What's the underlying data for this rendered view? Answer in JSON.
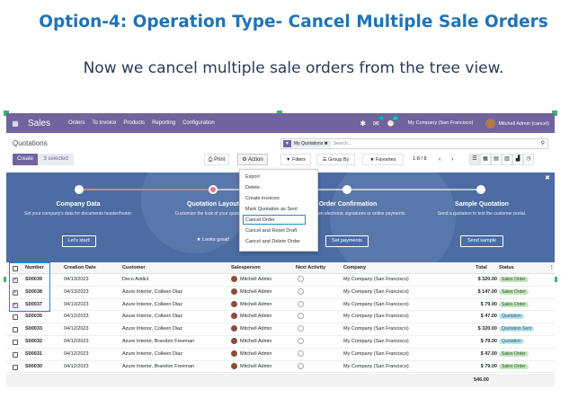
{
  "heading": "Option-4: Operation Type- Cancel Multiple Sale Orders",
  "subheading": "Now we cancel multiple sale orders from the tree view.",
  "colors": {
    "heading": "#1f73b7",
    "navbar": "#71639e",
    "banner": "#4d6ca4"
  },
  "navbar": {
    "app_name": "Sales",
    "menus": [
      "Orders",
      "To Invoice",
      "Products",
      "Reporting",
      "Configuration"
    ],
    "chat_count": "7",
    "activity_count": "27",
    "company": "My Company (San Francisco)",
    "user": "Mitchell Admin (cancel)"
  },
  "control": {
    "breadcrumb": "Quotations",
    "create_label": "Create",
    "selected_label": "3 selected",
    "print_label": "Print",
    "action_label": "Action",
    "facet": "My Quotations",
    "search_placeholder": "Search...",
    "filters_label": "Filters",
    "groupby_label": "Group By",
    "favorites_label": "Favorites",
    "pager": "1-8 / 8"
  },
  "banner": {
    "steps": [
      {
        "title": "Company Data",
        "desc": "Set your company's data for documents header/footer.",
        "button": "Let's start!"
      },
      {
        "title": "Quotation Layout",
        "desc": "Customize the look of your quotations.",
        "button": "Looks great!"
      },
      {
        "title": "Order Confirmation",
        "desc": "Choose between electronic signatures or online payments.",
        "button": "Set payments"
      },
      {
        "title": "Sample Quotation",
        "desc": "Send a quotation to test the customer portal.",
        "button": "Send sample"
      }
    ]
  },
  "dropdown": {
    "items": [
      "Export",
      "Delete",
      "Create invoices",
      "Mark Quotation as Sent",
      "Cancel Order",
      "Cancel and Reset Draft",
      "Cancel and Delete Order"
    ]
  },
  "table": {
    "headers": [
      "Number",
      "Creation Date",
      "Customer",
      "Salesperson",
      "Next Activity",
      "Company",
      "Total",
      "Status"
    ],
    "rows": [
      {
        "number": "S00039",
        "date": "04/13/2023",
        "customer": "Deco Addict",
        "salesperson": "Mitchell Admin",
        "company": "My Company (San Francisco)",
        "total": "$ 320.00",
        "status": "Sales Order",
        "checked": true
      },
      {
        "number": "S00038",
        "date": "04/13/2023",
        "customer": "Azure Interior, Colleen Diaz",
        "salesperson": "Mitchell Admin",
        "company": "My Company (San Francisco)",
        "total": "$ 147.00",
        "status": "Sales Order",
        "checked": true
      },
      {
        "number": "S00037",
        "date": "04/13/2023",
        "customer": "Azure Interior, Colleen Diaz",
        "salesperson": "Mitchell Admin",
        "company": "My Company (San Francisco)",
        "total": "$ 79.00",
        "status": "Sales Order",
        "checked": true
      },
      {
        "number": "S00035",
        "date": "04/12/2023",
        "customer": "Azure Interior, Colleen Diaz",
        "salesperson": "Mitchell Admin",
        "company": "My Company (San Francisco)",
        "total": "$ 47.00",
        "status": "Quotation",
        "checked": false
      },
      {
        "number": "S00033",
        "date": "04/12/2023",
        "customer": "Azure Interior, Colleen Diaz",
        "salesperson": "Mitchell Admin",
        "company": "My Company (San Francisco)",
        "total": "$ 320.00",
        "status": "Quotation Sent",
        "checked": false
      },
      {
        "number": "S00032",
        "date": "04/12/2023",
        "customer": "Azure Interior, Brandon Freeman",
        "salesperson": "Mitchell Admin",
        "company": "My Company (San Francisco)",
        "total": "$ 79.00",
        "status": "Quotation",
        "checked": false
      },
      {
        "number": "S00031",
        "date": "04/12/2023",
        "customer": "Azure Interior, Colleen Diaz",
        "salesperson": "Mitchell Admin",
        "company": "My Company (San Francisco)",
        "total": "$ 47.00",
        "status": "Sales Order",
        "checked": false
      },
      {
        "number": "S00030",
        "date": "04/12/2023",
        "customer": "Azure Interior, Brandon Freeman",
        "salesperson": "Mitchell Admin",
        "company": "My Company (San Francisco)",
        "total": "$ 79.00",
        "status": "Sales Order",
        "checked": false
      }
    ],
    "sum_total": "546.00"
  }
}
